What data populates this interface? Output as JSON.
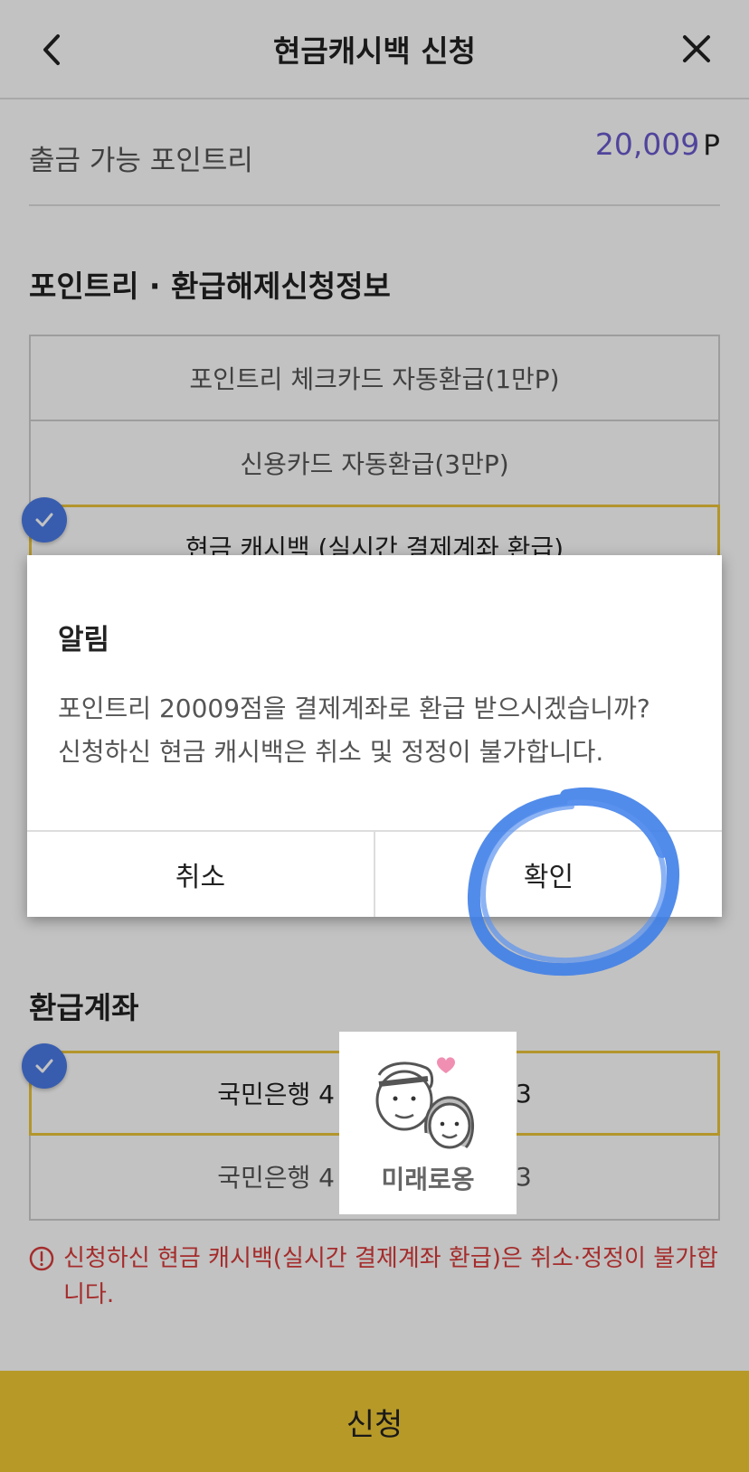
{
  "header": {
    "title": "현금캐시백 신청",
    "back_icon": "chevron-left-icon",
    "close_icon": "close-icon"
  },
  "points": {
    "label": "출금 가능 포인트리",
    "value": "20,009",
    "unit": "P"
  },
  "refund_section": {
    "title": "포인트리 · 환급해제신청정보",
    "options": [
      "포인트리 체크카드 자동환급(1만P)",
      "신용카드 자동환급(3만P)",
      "현금 캐시백 (실시간 결제계좌 환급)"
    ],
    "selected_index": 2
  },
  "account_section": {
    "title": "환급계좌",
    "accounts": [
      "국민은행 4",
      "국민은행 4"
    ],
    "account_suffix": "3",
    "selected_index": 0
  },
  "warning": {
    "text": "신청하신 현금 캐시백(실시간 결제계좌 환급)은 취소·정정이 불가합니다."
  },
  "apply_button": "신청",
  "dialog": {
    "title": "알림",
    "message_line1": "포인트리 20009점을 결제계좌로 환급 받으시겠습니까?",
    "message_line2": "신청하신 현금 캐시백은 취소 및 정정이 불가합니다.",
    "cancel_label": "취소",
    "confirm_label": "확인"
  },
  "sticker": {
    "text": "미래로옹"
  },
  "colors": {
    "accent_yellow": "#f1c935",
    "check_blue": "#4a7be6",
    "points_purple": "#6a5acd",
    "warning_red": "#d93a3a",
    "annotation_blue": "#3f7fe8"
  }
}
